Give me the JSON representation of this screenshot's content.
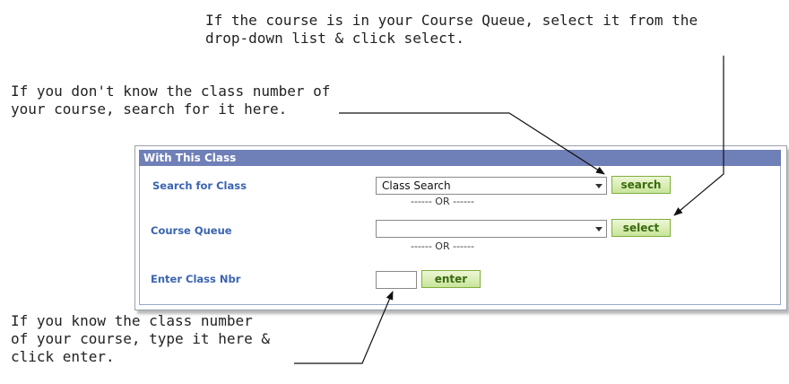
{
  "callouts": {
    "top": [
      "If the course is in your Course Queue, select it from the",
      "drop-down list & click select."
    ],
    "left": [
      "If you don't know the class number of",
      "your course, search for it here."
    ],
    "bottom": [
      "If you know the class number",
      "of your course, type it here &",
      "click enter."
    ]
  },
  "panel": {
    "title": "With This Class",
    "search": {
      "label": "Search for Class",
      "selected": "Class Search",
      "button": "search"
    },
    "or_text": "------ OR ------",
    "queue": {
      "label": "Course Queue",
      "selected": "",
      "button": "select"
    },
    "class_nbr": {
      "label": "Enter Class Nbr",
      "value": "",
      "button": "enter"
    }
  }
}
